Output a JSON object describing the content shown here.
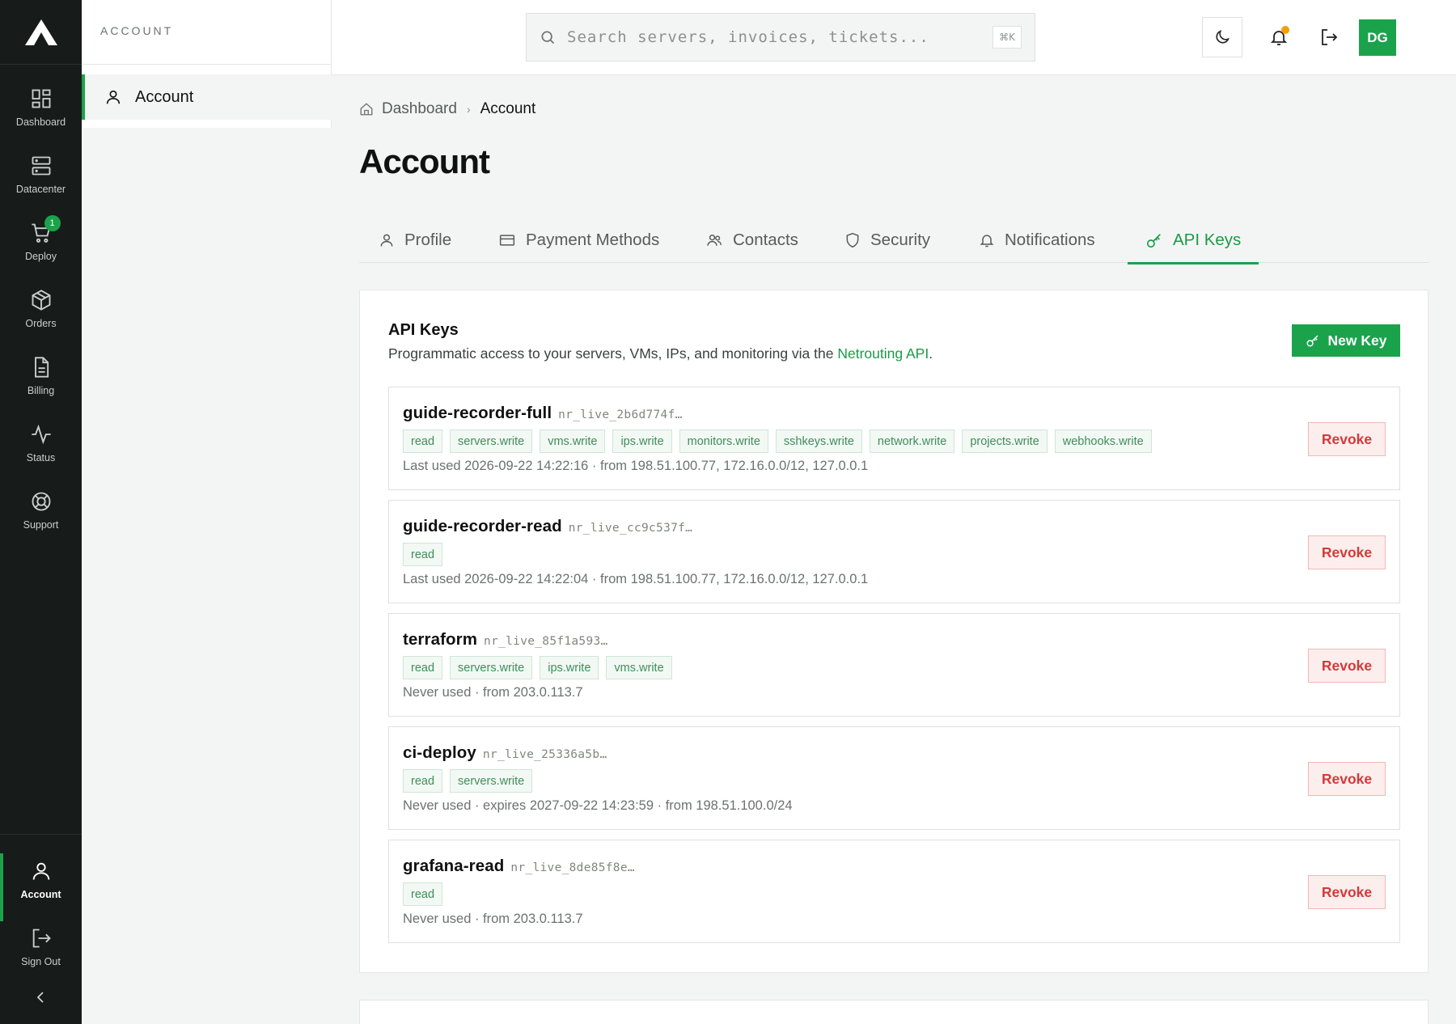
{
  "rail": {
    "items": [
      {
        "label": "Dashboard",
        "icon": "grid-icon"
      },
      {
        "label": "Datacenter",
        "icon": "server-icon"
      },
      {
        "label": "Deploy",
        "icon": "cart-icon",
        "badge": "1"
      },
      {
        "label": "Orders",
        "icon": "box-icon"
      },
      {
        "label": "Billing",
        "icon": "document-icon"
      },
      {
        "label": "Status",
        "icon": "activity-icon"
      },
      {
        "label": "Support",
        "icon": "lifebuoy-icon"
      }
    ],
    "bottom": [
      {
        "label": "Account",
        "icon": "user-icon"
      },
      {
        "label": "Sign Out",
        "icon": "logout-icon"
      }
    ]
  },
  "subnav": {
    "title": "ACCOUNT",
    "item": "Account"
  },
  "topbar": {
    "search_placeholder": "Search servers, invoices, tickets...",
    "shortcut": "⌘K",
    "avatar": "DG"
  },
  "breadcrumb": {
    "root": "Dashboard",
    "current": "Account"
  },
  "page": {
    "title": "Account"
  },
  "tabs": [
    {
      "label": "Profile",
      "icon": "user-icon"
    },
    {
      "label": "Payment Methods",
      "icon": "credit-card-icon"
    },
    {
      "label": "Contacts",
      "icon": "users-icon"
    },
    {
      "label": "Security",
      "icon": "shield-icon"
    },
    {
      "label": "Notifications",
      "icon": "bell-icon"
    },
    {
      "label": "API Keys",
      "icon": "key-icon",
      "active": true
    }
  ],
  "api_keys": {
    "title": "API Keys",
    "description": "Programmatic access to your servers, VMs, IPs, and monitoring via the ",
    "link_text": "Netrouting API",
    "description_end": ".",
    "new_key_label": "New Key",
    "revoke_label": "Revoke",
    "keys": [
      {
        "name": "guide-recorder-full",
        "id": "nr_live_2b6d774f…",
        "scopes": [
          "read",
          "servers.write",
          "vms.write",
          "ips.write",
          "monitors.write",
          "sshkeys.write",
          "network.write",
          "projects.write",
          "webhooks.write"
        ],
        "meta": "Last used 2026-09-22 14:22:16 · from 198.51.100.77, 172.16.0.0/12, 127.0.0.1"
      },
      {
        "name": "guide-recorder-read",
        "id": "nr_live_cc9c537f…",
        "scopes": [
          "read"
        ],
        "meta": "Last used 2026-09-22 14:22:04 · from 198.51.100.77, 172.16.0.0/12, 127.0.0.1"
      },
      {
        "name": "terraform",
        "id": "nr_live_85f1a593…",
        "scopes": [
          "read",
          "servers.write",
          "ips.write",
          "vms.write"
        ],
        "meta": "Never used · from 203.0.113.7"
      },
      {
        "name": "ci-deploy",
        "id": "nr_live_25336a5b…",
        "scopes": [
          "read",
          "servers.write"
        ],
        "meta": "Never used · expires 2027-09-22 14:23:59 · from 198.51.100.0/24"
      },
      {
        "name": "grafana-read",
        "id": "nr_live_8de85f8e…",
        "scopes": [
          "read"
        ],
        "meta": "Never used · from 203.0.113.7"
      }
    ]
  },
  "colors": {
    "accent": "#1aa34a",
    "rail_bg": "#171c1a",
    "danger": "#d23a3a",
    "notification_dot": "#f59e0b"
  }
}
